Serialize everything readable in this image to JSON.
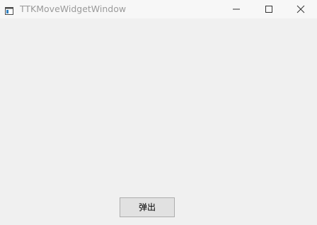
{
  "window": {
    "title": "TTKMoveWidgetWindow",
    "controls": {
      "minimize": "minimize-icon",
      "maximize": "maximize-icon",
      "close": "close-icon"
    }
  },
  "main": {
    "popup_button_label": "弹出"
  },
  "colors": {
    "titlebar_bg": "#f7f7f7",
    "window_bg": "#f0f0f0",
    "button_bg": "#e1e1e1",
    "button_border": "#adadad",
    "title_text": "#9a9a9a"
  }
}
